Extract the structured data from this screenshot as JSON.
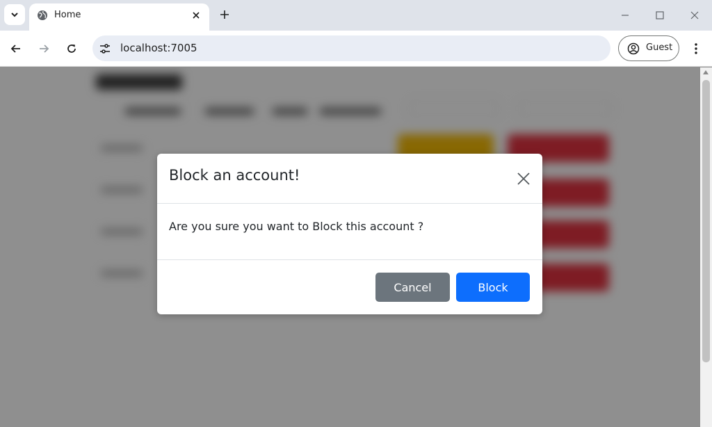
{
  "browser": {
    "tab_title": "Home",
    "url": "localhost:7005",
    "profile_label": "Guest",
    "icons": {
      "tab_search": "chevron-down-icon",
      "favicon": "globe-icon",
      "tab_close": "close-icon",
      "new_tab": "plus-icon",
      "minimize": "minimize-icon",
      "maximize": "maximize-icon",
      "close_window": "close-icon",
      "back": "arrow-left-icon",
      "forward": "arrow-right-icon",
      "reload": "reload-icon",
      "site_info": "tune-icon",
      "profile": "account-circle-icon",
      "menu": "more-vertical-icon"
    }
  },
  "modal": {
    "title": "Block an account!",
    "message": "Are you sure you want to Block this account ?",
    "cancel_label": "Cancel",
    "confirm_label": "Block",
    "colors": {
      "cancel": "#6c757d",
      "confirm": "#0d6efd"
    }
  },
  "background_colors": {
    "warning_button": "#f3b906",
    "danger_button": "#e03240"
  }
}
